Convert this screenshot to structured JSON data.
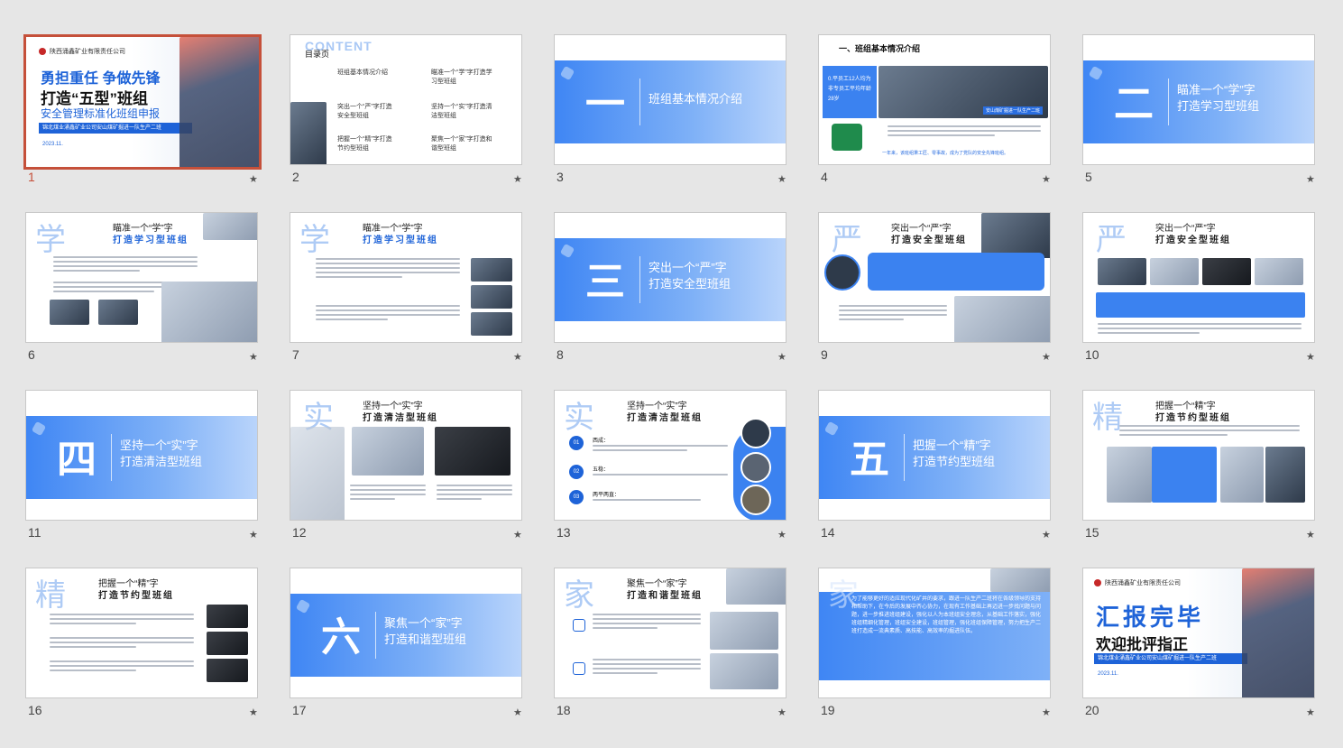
{
  "slides": [
    {
      "num": "1",
      "company": "陕西涌鑫矿业有限责任公司",
      "line1": "勇担重任  争做先锋",
      "line2": "打造“五型”班组",
      "line3": "安全管理标准化班组申报",
      "ribbon": "锦北煤业涌鑫矿业公司安山煤矿掘进一队生产二班",
      "date": "2023.11."
    },
    {
      "num": "2",
      "content": "CONTENT",
      "heading": "目录页",
      "items": [
        "班组基本情况介绍",
        "瞄准一个“学”字打造学习型班组",
        "突出一个“严”字打造安全型班组",
        "坚持一个“实”字打造清洁型班组",
        "把握一个“精”字打造节约型班组",
        "聚焦一个“家”字打造和谐型班组"
      ]
    },
    {
      "num": "3",
      "big": "一",
      "t1": "班组基本情况介绍",
      "t2": ""
    },
    {
      "num": "4",
      "title": "一、班组基本情况介绍",
      "stat": "0.平员工12人均为非专员工平均年龄28岁",
      "caption": "安山煤矿掘进一队生产二班",
      "footer": "一年来，该班组秉工匠、零事故，成为了党队的安全先锋班组。"
    },
    {
      "num": "5",
      "big": "二",
      "t1": "瞄准一个“学”字",
      "t2": "打造学习型班组"
    },
    {
      "num": "6",
      "char": "学",
      "h1": "瞄准一个“学”字",
      "h2": "打造学习型班组"
    },
    {
      "num": "7",
      "char": "学",
      "h1": "瞄准一个“学”字",
      "h2": "打造学习型班组"
    },
    {
      "num": "8",
      "big": "三",
      "t1": "突出一个“严”字",
      "t2": "打造安全型班组"
    },
    {
      "num": "9",
      "char": "严",
      "h1": "突出一个“严”字",
      "h2": "打造安全型班组"
    },
    {
      "num": "10",
      "char": "严",
      "h1": "突出一个“严”字",
      "h2": "打造安全型班组"
    },
    {
      "num": "11",
      "big": "四",
      "t1": "坚持一个“实”字",
      "t2": "打造清洁型班组"
    },
    {
      "num": "12",
      "char": "实",
      "h1": "坚持一个“实”字",
      "h2": "打造清洁型班组"
    },
    {
      "num": "13",
      "char": "实",
      "h1": "坚持一个“实”字",
      "h2": "打造清洁型班组",
      "badges": [
        "01",
        "02",
        "03"
      ],
      "labels": [
        "西成：",
        "五稳：",
        "两平两直："
      ]
    },
    {
      "num": "14",
      "big": "五",
      "t1": "把握一个“精”字",
      "t2": "打造节约型班组"
    },
    {
      "num": "15",
      "char": "精",
      "h1": "把握一个“精”字",
      "h2": "打造节约型班组"
    },
    {
      "num": "16",
      "char": "精",
      "h1": "把握一个“精”字",
      "h2": "打造节约型班组"
    },
    {
      "num": "17",
      "big": "六",
      "t1": "聚焦一个“家”字",
      "t2": "打造和谐型班组"
    },
    {
      "num": "18",
      "char": "家",
      "h1": "聚焦一个“家”字",
      "h2": "打造和谐型班组"
    },
    {
      "num": "19",
      "char": "家",
      "body": "为了能够更好的适应现代化矿井的要求，跟进一队生产二班将在各级领导的支持和帮助下，在今后的发展中齐心协力，在现有工作基础上再迈进一步找问题与问题，进一步推进班组建设，强化以人为本班组安全理念，从基础工作落实，强化班组精细化管理，班组安全建设，班组管理，强化班组保障管理，努力把生产二班打造成一流典素质、高技能、高效率的掘进队伍。"
    },
    {
      "num": "20",
      "company": "陕西涌鑫矿业有限责任公司",
      "line1": "汇报完毕",
      "line2": "欢迎批评指正",
      "ribbon": "锦北煤业涌鑫矿业公司安山煤矿掘进一队生产二班",
      "date": "2023.11."
    }
  ],
  "colors": {
    "accent": "#3f86f4",
    "selected": "#c5503a",
    "title_blue": "#1e63d8"
  }
}
